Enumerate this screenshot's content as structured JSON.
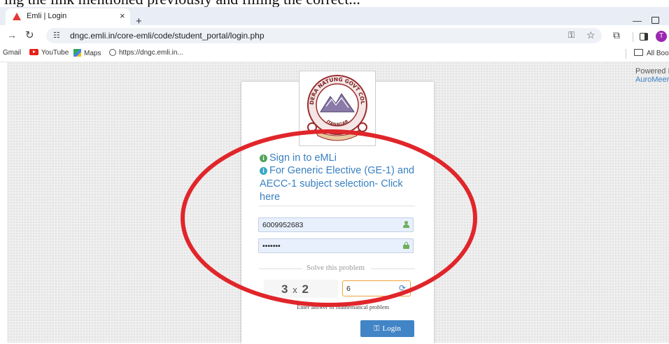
{
  "caption": "ing the link mentioned previously and filling the correct...",
  "browser": {
    "tab_title": "Emli | Login",
    "tab_close": "×",
    "new_tab": "+",
    "minimize": "—",
    "url": "dngc.emli.in/core-emli/code/student_portal/login.php",
    "profile_initial": "T",
    "bookmarks": [
      {
        "label": "Gmail"
      },
      {
        "label": "YouTube",
        "icon": "youtube-icon"
      },
      {
        "label": "Maps",
        "icon": "maps-icon"
      },
      {
        "label": "https://dngc.emli.in...",
        "icon": "globe-icon"
      }
    ],
    "all_bookmarks": "All Book"
  },
  "page": {
    "powered_by": "Powered I",
    "powered_link": "AuroMeer",
    "logo": {
      "top_text": "DERA NATUNG GOVT COLLEGE",
      "bottom_text": "ITANAGAR"
    },
    "info_links": [
      {
        "text": "Sign in to eMLi",
        "icon": "info-icon"
      },
      {
        "text": "For Generic Elective (GE-1) and",
        "icon": "info-icon"
      },
      {
        "text": "AECC-1 subject selection- Click"
      },
      {
        "text": "here"
      }
    ],
    "username_value": "6009952683",
    "password_value": "•••••••",
    "solve_title": "Solve this problem",
    "captcha": {
      "a": "3",
      "op": "x",
      "b": "2"
    },
    "answer_value": "6",
    "hint": "Enter answer of mathematical problem",
    "login_label": "Login"
  },
  "colors": {
    "annotation": "#e0262b",
    "link": "#3a80c1",
    "button": "#4285c6"
  }
}
